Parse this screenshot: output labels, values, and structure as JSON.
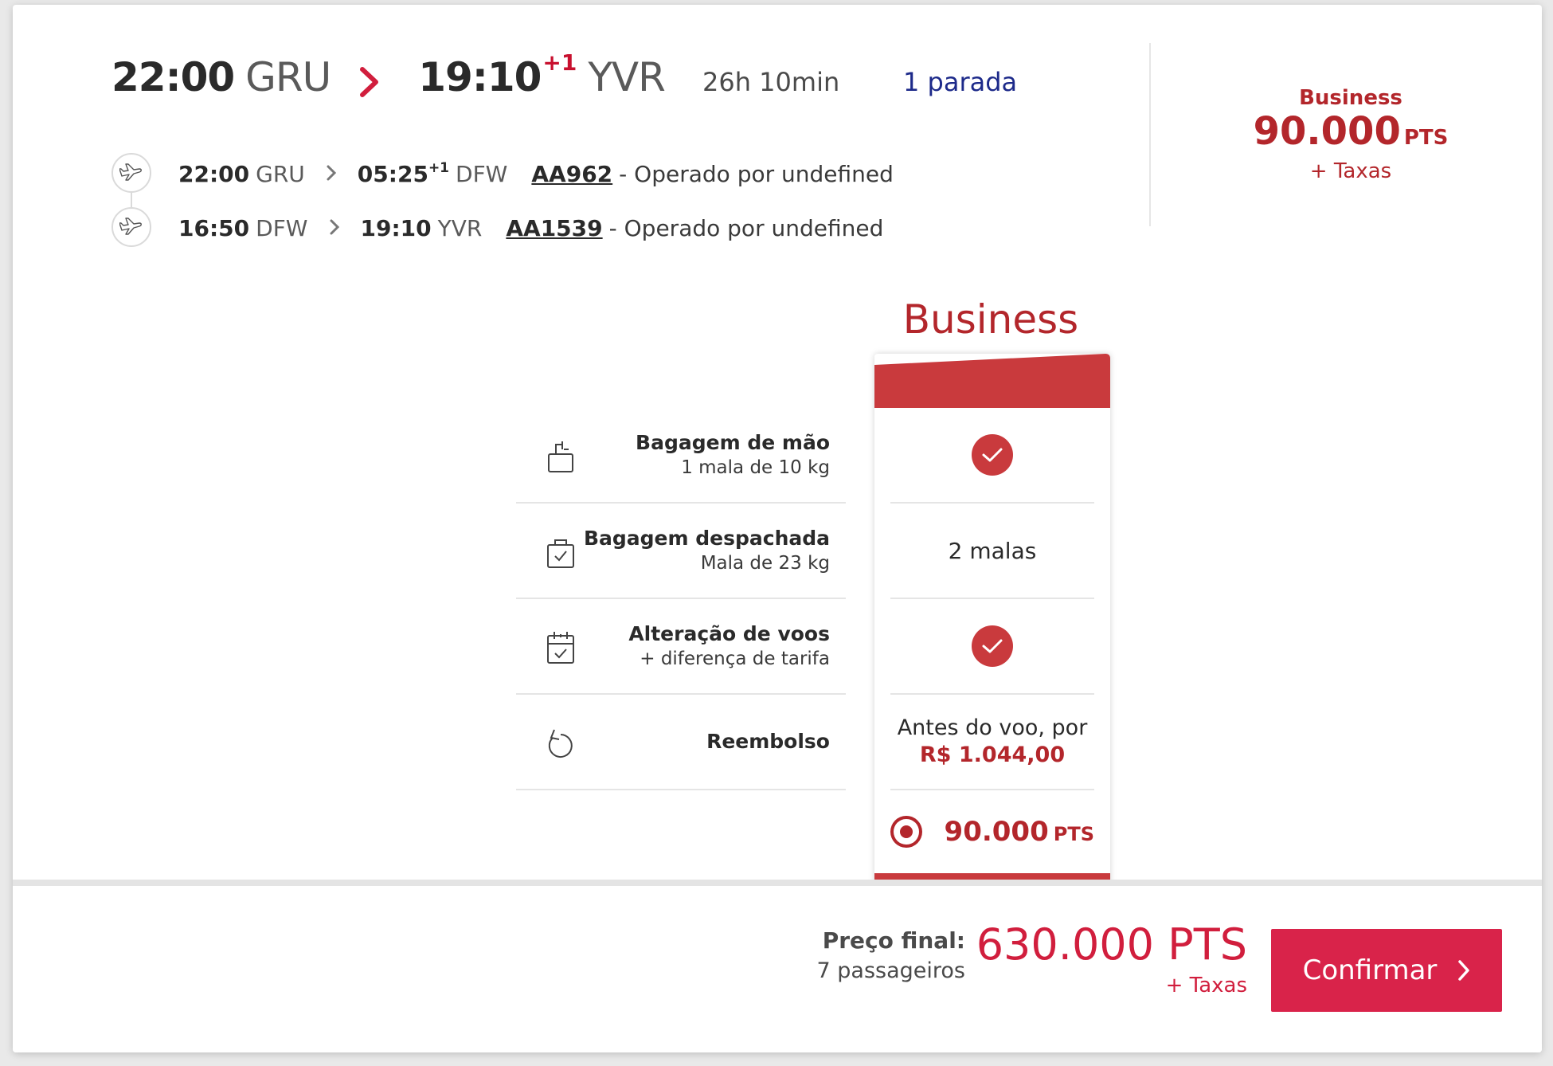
{
  "route": {
    "dep_time": "22:00",
    "dep_airport": "GRU",
    "arr_time": "19:10",
    "arr_dayplus": "+1",
    "arr_airport": "YVR",
    "duration": "26h 10min",
    "stops": "1 parada"
  },
  "price_summary": {
    "class": "Business",
    "points": "90.000",
    "points_unit": "PTS",
    "taxes": "+ Taxas"
  },
  "segments": [
    {
      "icon": "airplane-icon",
      "dep_time": "22:00",
      "dep_airport": "GRU",
      "arr_time": "05:25",
      "arr_dayplus": "+1",
      "arr_airport": "DFW",
      "flight": "AA962",
      "operator": "- Operado por undefined"
    },
    {
      "icon": "airplane-icon",
      "dep_time": "16:50",
      "dep_airport": "DFW",
      "arr_time": "19:10",
      "arr_dayplus": "",
      "arr_airport": "YVR",
      "flight": "AA1539",
      "operator": "- Operado por undefined"
    }
  ],
  "fare": {
    "title": "Business",
    "features": [
      {
        "icon": "carry-on-bag-icon",
        "title": "Bagagem de mão",
        "subtitle": "1 mala de 10 kg"
      },
      {
        "icon": "checked-bag-icon",
        "title": "Bagagem despachada",
        "subtitle": "Mala de 23 kg"
      },
      {
        "icon": "calendar-change-icon",
        "title": "Alteração de voos",
        "subtitle": "+ diferença de tarifa"
      },
      {
        "icon": "refund-icon",
        "title": "Reembolso",
        "subtitle": ""
      }
    ],
    "values": {
      "carry_on": "included",
      "checked_bags": "2 malas",
      "change": "included",
      "refund_line1": "Antes do voo, por",
      "refund_price": "R$ 1.044,00"
    },
    "select_points": "90.000",
    "select_unit": "PTS",
    "selected": true
  },
  "footer": {
    "final_label": "Preço final:",
    "passengers": "7 passageiros",
    "total": "630.000 PTS",
    "taxes": "+ Taxas",
    "confirm_label": "Confirmar"
  },
  "colors": {
    "brand_red": "#c93a3d",
    "price_red": "#b3262b",
    "button_red": "#d9234a",
    "stops_blue": "#1d2a8a"
  }
}
